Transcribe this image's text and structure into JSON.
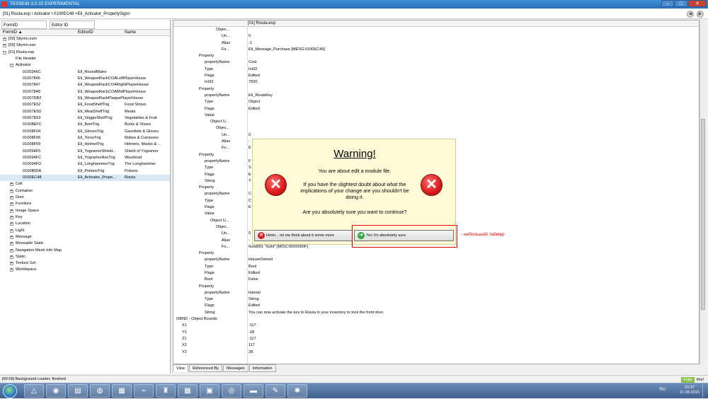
{
  "window": {
    "title": "TES5Edit 3.0.32 EXPERIMENTAL",
    "min": "–",
    "max": "□",
    "close": "✕"
  },
  "path": "[01] Routa.esp \\ Activator \\ 0100EC48 <Eli_Activator_PropertySign>",
  "nav": {
    "back": "◀",
    "forward": "▶"
  },
  "left": {
    "filters": [
      "FormID",
      "Editor ID"
    ],
    "columns": [
      "FormID ▲",
      "EditorID",
      "Name"
    ],
    "tree": [
      {
        "form": "[00] Skyrim.esm",
        "editor": "",
        "name": "",
        "indent": 0,
        "exp": "+"
      },
      {
        "form": "[00] Skyrim.exe",
        "editor": "",
        "name": "",
        "indent": 0,
        "exp": "+"
      },
      {
        "form": "[01] Routa.esp",
        "editor": "",
        "name": "",
        "indent": 0,
        "exp": "−"
      },
      {
        "form": "File Header",
        "editor": "",
        "name": "",
        "indent": 1,
        "exp": ""
      },
      {
        "form": "Activator",
        "editor": "",
        "name": "",
        "indent": 1,
        "exp": "−"
      },
      {
        "form": "0100346C",
        "editor": "Eli_RoundWater",
        "name": "",
        "indent": 2,
        "exp": ""
      },
      {
        "form": "01007846",
        "editor": "Eli_WeaponRackCOALeftPlayerHouse",
        "name": "",
        "indent": 2,
        "exp": ""
      },
      {
        "form": "01007847",
        "editor": "Eli_WeaponRackCOARightPlayerHouse",
        "name": "",
        "indent": 2,
        "exp": ""
      },
      {
        "form": "01007848",
        "editor": "Eli_WeaponRackCOAMidPlayerHouse",
        "name": "",
        "indent": 2,
        "exp": ""
      },
      {
        "form": "01007DB2",
        "editor": "Eli_WeaponRackPlaquePlayerHouse",
        "name": "",
        "indent": 2,
        "exp": ""
      },
      {
        "form": "01007E52",
        "editor": "Eli_FoodShelfTrig",
        "name": "Food Stores",
        "indent": 2,
        "exp": ""
      },
      {
        "form": "01007E5D",
        "editor": "Eli_MeatShelfTrig",
        "name": "Meats",
        "indent": 2,
        "exp": ""
      },
      {
        "form": "01007E63",
        "editor": "Eli_VeggieShelfTrig",
        "name": "Vegetables & Fruit",
        "indent": 2,
        "exp": ""
      },
      {
        "form": "01008EFC",
        "editor": "Eli_BootTrig",
        "name": "Boots & Shoes",
        "indent": 2,
        "exp": ""
      },
      {
        "form": "01008F04",
        "editor": "Eli_GlovesTrig",
        "name": "Gauntlets & Gloves",
        "indent": 2,
        "exp": ""
      },
      {
        "form": "01008F06",
        "editor": "Eli_TorsoTrig",
        "name": "Robes & Cuirasses",
        "indent": 2,
        "exp": ""
      },
      {
        "form": "01008F09",
        "editor": "Eli_HelmetTrig",
        "name": "Helmets, Masks & ...",
        "indent": 2,
        "exp": ""
      },
      {
        "form": "010094F5",
        "editor": "Eli_YsgramorShield...",
        "name": "Shield of Ysgramor",
        "indent": 2,
        "exp": ""
      },
      {
        "form": "010094FC",
        "editor": "Eli_YsgramorAxeTrig",
        "name": "Wuuthrad",
        "indent": 2,
        "exp": ""
      },
      {
        "form": "010094FD",
        "editor": "Eli_LonghammerTrig",
        "name": "The Longhammer",
        "indent": 2,
        "exp": ""
      },
      {
        "form": "0100B05A",
        "editor": "Eli_PotionsTrig",
        "name": "Potions",
        "indent": 2,
        "exp": ""
      },
      {
        "form": "0100EC48",
        "editor": "Eli_Activator_Prope...",
        "name": "Routa",
        "indent": 2,
        "exp": "",
        "selected": true
      },
      {
        "form": "Cell",
        "editor": "",
        "name": "",
        "indent": 1,
        "exp": "+"
      },
      {
        "form": "Container",
        "editor": "",
        "name": "",
        "indent": 1,
        "exp": "+"
      },
      {
        "form": "Door",
        "editor": "",
        "name": "",
        "indent": 1,
        "exp": "+"
      },
      {
        "form": "Furniture",
        "editor": "",
        "name": "",
        "indent": 1,
        "exp": "+"
      },
      {
        "form": "Image Space",
        "editor": "",
        "name": "",
        "indent": 1,
        "exp": "+"
      },
      {
        "form": "Key",
        "editor": "",
        "name": "",
        "indent": 1,
        "exp": "+"
      },
      {
        "form": "Location",
        "editor": "",
        "name": "",
        "indent": 1,
        "exp": "+"
      },
      {
        "form": "Light",
        "editor": "",
        "name": "",
        "indent": 1,
        "exp": "+"
      },
      {
        "form": "Message",
        "editor": "",
        "name": "",
        "indent": 1,
        "exp": "+"
      },
      {
        "form": "Moveable Static",
        "editor": "",
        "name": "",
        "indent": 1,
        "exp": "+"
      },
      {
        "form": "Navigation Mesh Info Map",
        "editor": "",
        "name": "",
        "indent": 1,
        "exp": "+"
      },
      {
        "form": "Static",
        "editor": "",
        "name": "",
        "indent": 1,
        "exp": "+"
      },
      {
        "form": "Texture Set",
        "editor": "",
        "name": "",
        "indent": 1,
        "exp": "+"
      },
      {
        "form": "Worldspace",
        "editor": "",
        "name": "",
        "indent": 1,
        "exp": "+"
      }
    ]
  },
  "right": {
    "header": "[01] Routa.esp",
    "rows": [
      {
        "k": "Objec...",
        "v": "",
        "ind": 7
      },
      {
        "k": "Un...",
        "v": "0",
        "ind": 8
      },
      {
        "k": "Alias",
        "v": "-1",
        "ind": 8
      },
      {
        "k": "Fo...",
        "v": "Eli_Message_Purchase [MESG:0100EC49]",
        "ind": 8
      },
      {
        "k": "Property",
        "v": "",
        "ind": 4
      },
      {
        "k": "propertyName",
        "v": "Cost",
        "ind": 5
      },
      {
        "k": "Type",
        "v": "Int32",
        "ind": 5
      },
      {
        "k": "Flags",
        "v": "Edited",
        "ind": 5
      },
      {
        "k": "Int32",
        "v": "7500",
        "ind": 5
      },
      {
        "k": "Property",
        "v": "",
        "ind": 4
      },
      {
        "k": "propertyName",
        "v": "Eli_RoutaKey",
        "ind": 5
      },
      {
        "k": "Type",
        "v": "Object",
        "ind": 5
      },
      {
        "k": "Flags",
        "v": "Edited",
        "ind": 5
      },
      {
        "k": "Value",
        "v": "",
        "ind": 5
      },
      {
        "k": "Object U...",
        "v": "",
        "ind": 6
      },
      {
        "k": "Objec...",
        "v": "",
        "ind": 7
      },
      {
        "k": "Un...",
        "v": "0",
        "ind": 8
      },
      {
        "k": "Alias",
        "v": "-",
        "ind": 8
      },
      {
        "k": "Fo...",
        "v": "E",
        "ind": 8
      },
      {
        "k": "Property",
        "v": "",
        "ind": 4
      },
      {
        "k": "propertyName",
        "v": "F",
        "ind": 5
      },
      {
        "k": "Type",
        "v": "S",
        "ind": 5
      },
      {
        "k": "Flags",
        "v": "E",
        "ind": 5
      },
      {
        "k": "String",
        "v": "Y",
        "ind": 5
      },
      {
        "k": "Property",
        "v": "",
        "ind": 4
      },
      {
        "k": "propertyName",
        "v": "C",
        "ind": 5
      },
      {
        "k": "Type",
        "v": "C",
        "ind": 5
      },
      {
        "k": "Flags",
        "v": "E",
        "ind": 5
      },
      {
        "k": "Value",
        "v": "",
        "ind": 5
      },
      {
        "k": "Object U...",
        "v": "",
        "ind": 6
      },
      {
        "k": "Objec...",
        "v": "",
        "ind": 7
      },
      {
        "k": "Un...",
        "v": "0",
        "ind": 8
      },
      {
        "k": "Alias",
        "v": "-",
        "ind": 8
      },
      {
        "k": "Fo...",
        "v": "Gold001 \"Gold\" [MISC:0000000F]",
        "ind": 8
      },
      {
        "k": "Property",
        "v": "",
        "ind": 4
      },
      {
        "k": "propertyName",
        "v": "HouseOwned",
        "ind": 5
      },
      {
        "k": "Type",
        "v": "Bool",
        "ind": 5
      },
      {
        "k": "Flags",
        "v": "Edited",
        "ind": 5
      },
      {
        "k": "Bool",
        "v": "False",
        "ind": 5
      },
      {
        "k": "Property",
        "v": "",
        "ind": 4
      },
      {
        "k": "propertyName",
        "v": "tutorial",
        "ind": 5
      },
      {
        "k": "Type",
        "v": "String",
        "ind": 5
      },
      {
        "k": "Flags",
        "v": "Edited",
        "ind": 5
      },
      {
        "k": "String",
        "v": "You can now activate the key to Routa in your inventory to lock the front door.",
        "ind": 5
      },
      {
        "k": "OBND - Object Bounds",
        "v": "",
        "ind": 0
      },
      {
        "k": "X1",
        "v": "-117",
        "ind": 1
      },
      {
        "k": "Y1",
        "v": "-28",
        "ind": 1
      },
      {
        "k": "Z1",
        "v": "-117",
        "ind": 1
      },
      {
        "k": "X2",
        "v": "117",
        "ind": 1
      },
      {
        "k": "Y2",
        "v": "28",
        "ind": 1
      }
    ]
  },
  "tabs": [
    "View",
    "Referenced By",
    "Messages",
    "Information"
  ],
  "status": {
    "text": "[00:09] Background Loader: finished",
    "badge": "Flattr",
    "extra": "this!"
  },
  "dialog": {
    "title": "Warning!",
    "line1": "You are about edit a module file.",
    "line2": "If you have the slightest doubt about what the implications of your change are you shouldn't be doing it.",
    "line3": "Are you absolutely sure you want to continue?",
    "icon": "✕",
    "no_button": "Hmm... let me think about it some more",
    "yes_button": "Yes I'm absolutely sure"
  },
  "annotation": "- небольшой таймер",
  "taskbar": {
    "lang": "RU",
    "time": "22:37",
    "date": "21.08.2015"
  },
  "colors": {
    "warning_bg": "#fffbd8",
    "annotation": "#e00000",
    "title_bar": "#2a6fb8"
  }
}
